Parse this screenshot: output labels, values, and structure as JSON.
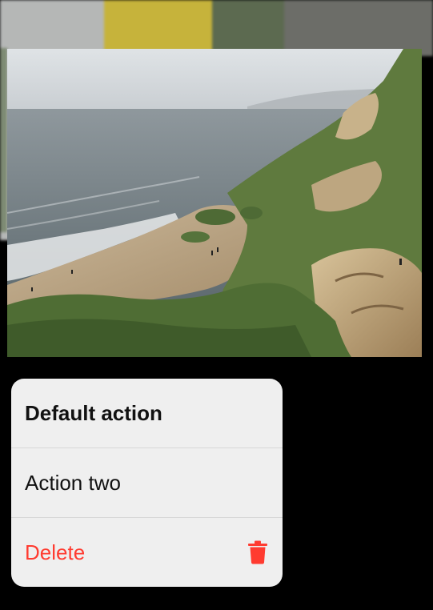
{
  "menu": {
    "items": [
      {
        "label": "Default action",
        "icon": null,
        "color": "#111111",
        "weight": "bold"
      },
      {
        "label": "Action two",
        "icon": null,
        "color": "#111111",
        "weight": "normal"
      },
      {
        "label": "Delete",
        "icon": "trash-icon",
        "color": "#ff3b30",
        "weight": "normal"
      }
    ]
  },
  "colors": {
    "background": "#000000",
    "menu_background": "#efefef",
    "destructive": "#ff3b30"
  },
  "preview": {
    "subject": "coastal-cliff-photo"
  }
}
